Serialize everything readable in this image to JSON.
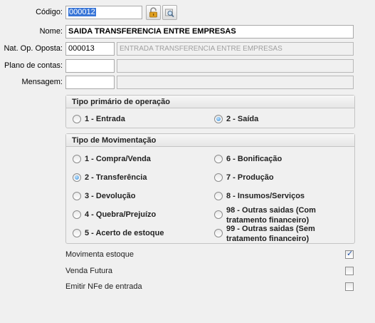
{
  "labels": {
    "codigo": "Código:",
    "nome": "Nome:",
    "nat_op_oposta": "Nat. Op. Oposta:",
    "plano_de_contas": "Plano de contas:",
    "mensagem": "Mensagem:"
  },
  "fields": {
    "codigo": "000012",
    "nome": "SAIDA TRANSFERENCIA ENTRE EMPRESAS",
    "nat_op_code": "000013",
    "nat_op_desc": "ENTRADA TRANSFERENCIA ENTRE EMPRESAS",
    "plano_code": "",
    "plano_desc": "",
    "mensagem_code": "",
    "mensagem_desc": ""
  },
  "icons": [
    "padlock-icon",
    "search-icon"
  ],
  "tipo_primario": {
    "title": "Tipo primário de operação",
    "options": [
      {
        "label": "1 - Entrada",
        "selected": false
      },
      {
        "label": "2 - Saída",
        "selected": true
      }
    ]
  },
  "tipo_movimentacao": {
    "title": "Tipo de Movimentação",
    "options": [
      {
        "label": "1 - Compra/Venda",
        "selected": false
      },
      {
        "label": "2 - Transferência",
        "selected": true
      },
      {
        "label": "3 - Devolução",
        "selected": false
      },
      {
        "label": "4 - Quebra/Prejuízo",
        "selected": false
      },
      {
        "label": "5 - Acerto de estoque",
        "selected": false
      },
      {
        "label": "6 - Bonificação",
        "selected": false
      },
      {
        "label": "7 - Produção",
        "selected": false
      },
      {
        "label": "8 - Insumos/Serviços",
        "selected": false
      },
      {
        "label": "98 - Outras saidas (Com tratamento financeiro)",
        "selected": false
      },
      {
        "label": "99 - Outras saidas (Sem tratamento financeiro)",
        "selected": false
      }
    ]
  },
  "checkboxes": [
    {
      "label": "Movimenta estoque",
      "checked": true
    },
    {
      "label": "Venda Futura",
      "checked": false
    },
    {
      "label": "Emitir NFe de entrada",
      "checked": false
    }
  ],
  "colors": {
    "accent": "#3875d7",
    "radio_on": "#3f8fd6",
    "window_bg": "#f0f0f0"
  }
}
